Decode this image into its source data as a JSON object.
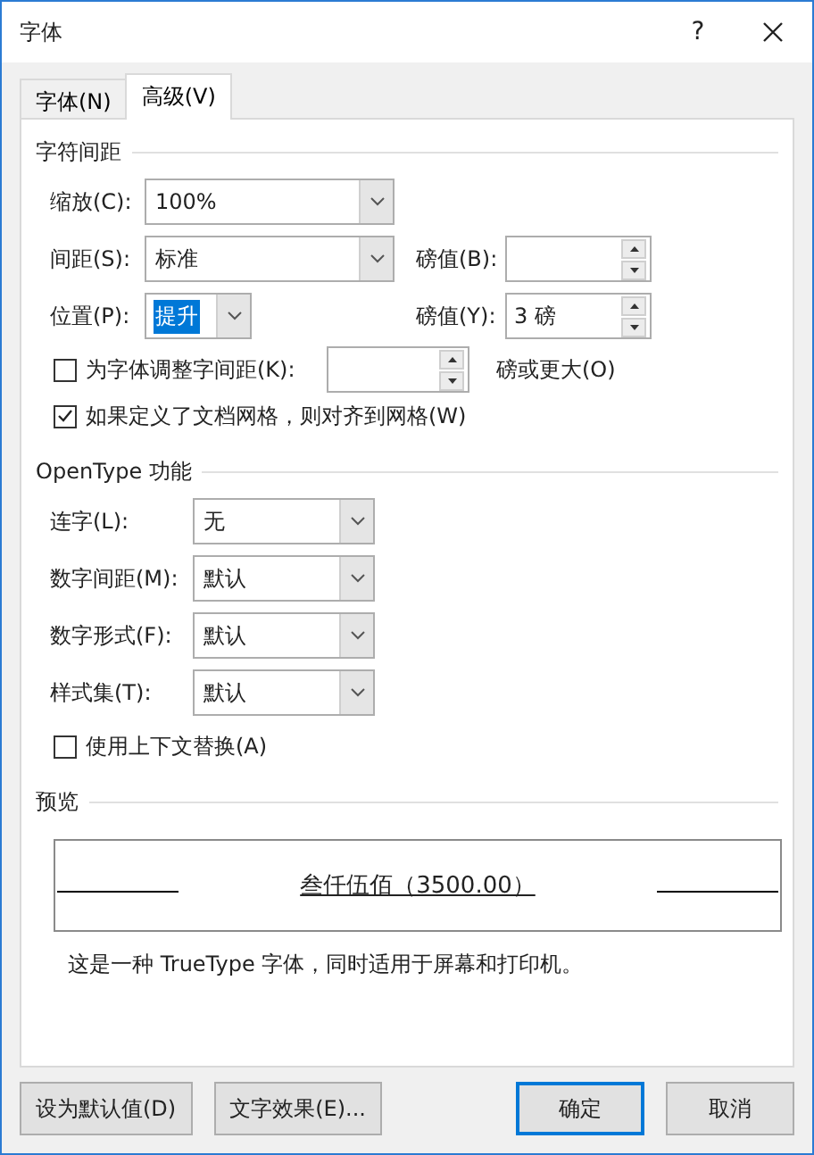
{
  "window": {
    "title": "字体",
    "help": "?"
  },
  "tabs": [
    {
      "label": "字体(N)",
      "selected": false
    },
    {
      "label": "高级(V)",
      "selected": true
    }
  ],
  "character_spacing": {
    "heading": "字符间距",
    "scale": {
      "label": "缩放(C):",
      "value": "100%"
    },
    "spacing": {
      "label": "间距(S):",
      "value": "标准",
      "by_label": "磅值(B):"
    },
    "position": {
      "label": "位置(P):",
      "value": "提升",
      "value_selected": true,
      "by_label": "磅值(Y):",
      "by_value": "3 磅"
    },
    "kerning": {
      "label": "为字体调整字间距(K):",
      "checked": false,
      "suffix": "磅或更大(O)"
    },
    "snap_to_grid": {
      "label": "如果定义了文档网格，则对齐到网格(W)",
      "checked": true
    }
  },
  "opentype": {
    "heading": "OpenType 功能",
    "dropdowns": [
      {
        "label": "连字(L):",
        "value": "无"
      },
      {
        "label": "数字间距(M):",
        "value": "默认"
      },
      {
        "label": "数字形式(F):",
        "value": "默认"
      },
      {
        "label": "样式集(T):",
        "value": "默认"
      }
    ],
    "contextual": {
      "label": "使用上下文替换(A)",
      "checked": false
    }
  },
  "preview": {
    "heading": "预览",
    "sample": "叁仟伍佰（3500.00）",
    "note": "这是一种 TrueType 字体，同时适用于屏幕和打印机。"
  },
  "buttons": [
    {
      "label": "设为默认值(D)",
      "default": false
    },
    {
      "label": "文字效果(E)...",
      "default": false
    },
    {
      "label": "确定",
      "default": true
    },
    {
      "label": "取消",
      "default": false
    }
  ]
}
